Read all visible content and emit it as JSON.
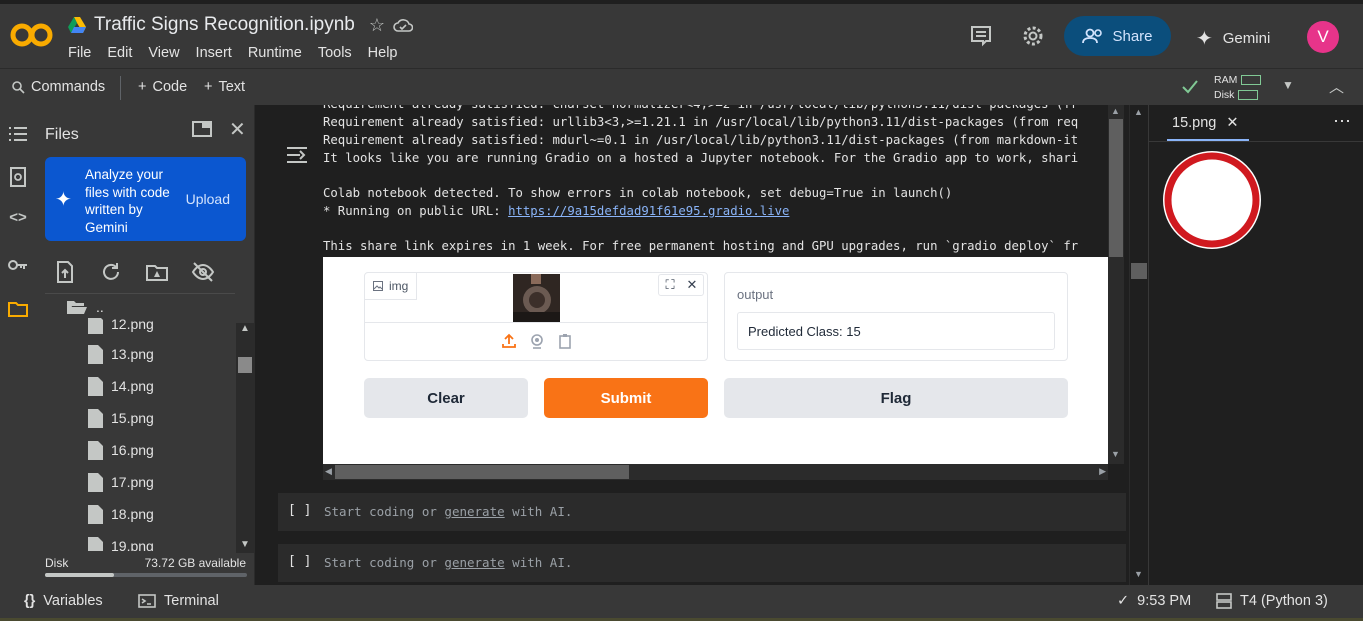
{
  "app": {
    "notebook_title": "Traffic Signs Recognition.ipynb",
    "menu": [
      "File",
      "Edit",
      "View",
      "Insert",
      "Runtime",
      "Tools",
      "Help"
    ],
    "share_label": "Share",
    "gemini_label": "Gemini",
    "avatar_letter": "V",
    "accent_colors": {
      "logo": "#f9ab00",
      "share_bg": "#0b4e7c",
      "avatar": "#e7348a"
    }
  },
  "toolbar": {
    "commands_label": "Commands",
    "code_label": "Code",
    "text_label": "Text",
    "ram_label": "RAM",
    "disk_label": "Disk"
  },
  "files_panel": {
    "title": "Files",
    "gemini_card": {
      "text": "Analyze your files with code written by Gemini",
      "upload_label": "Upload"
    },
    "parent_dir": "..",
    "items": [
      "12.png",
      "13.png",
      "14.png",
      "15.png",
      "16.png",
      "17.png",
      "18.png",
      "19.png"
    ],
    "disk_label": "Disk",
    "disk_available": "73.72 GB available",
    "disk_used_fraction": 0.34
  },
  "output": {
    "lines": [
      "Requirement already satisfied: charset-normalizer<4,>=2 in /usr/local/lib/python3.11/dist-packages (fr",
      "Requirement already satisfied: urllib3<3,>=1.21.1 in /usr/local/lib/python3.11/dist-packages (from req",
      "Requirement already satisfied: mdurl~=0.1 in /usr/local/lib/python3.11/dist-packages (from markdown-it",
      "It looks like you are running Gradio on a hosted a Jupyter notebook. For the Gradio app to work, shari",
      "",
      "Colab notebook detected. To show errors in colab notebook, set debug=True in launch()"
    ],
    "public_url_prefix": "* Running on public URL: ",
    "public_url": "https://9a15defdad91f61e95.gradio.live",
    "expire_line": "This share link expires in 1 week. For free permanent hosting and GPU upgrades, run `gradio deploy` fr"
  },
  "gradio": {
    "img_label": "img",
    "output_label": "output",
    "output_value": "Predicted Class: 15",
    "clear_label": "Clear",
    "submit_label": "Submit",
    "flag_label": "Flag",
    "submit_color": "#f97316"
  },
  "cells": [
    {
      "brackets": "[ ]",
      "placeholder_pre": "Start coding or ",
      "placeholder_link": "generate",
      "placeholder_post": " with AI."
    },
    {
      "brackets": "[ ]",
      "placeholder_pre": "Start coding or ",
      "placeholder_link": "generate",
      "placeholder_post": " with AI."
    }
  ],
  "right_panel": {
    "tab_label": "15.png"
  },
  "status": {
    "variables_label": "Variables",
    "terminal_label": "Terminal",
    "time": "9:53 PM",
    "runtime": "T4 (Python 3)"
  }
}
